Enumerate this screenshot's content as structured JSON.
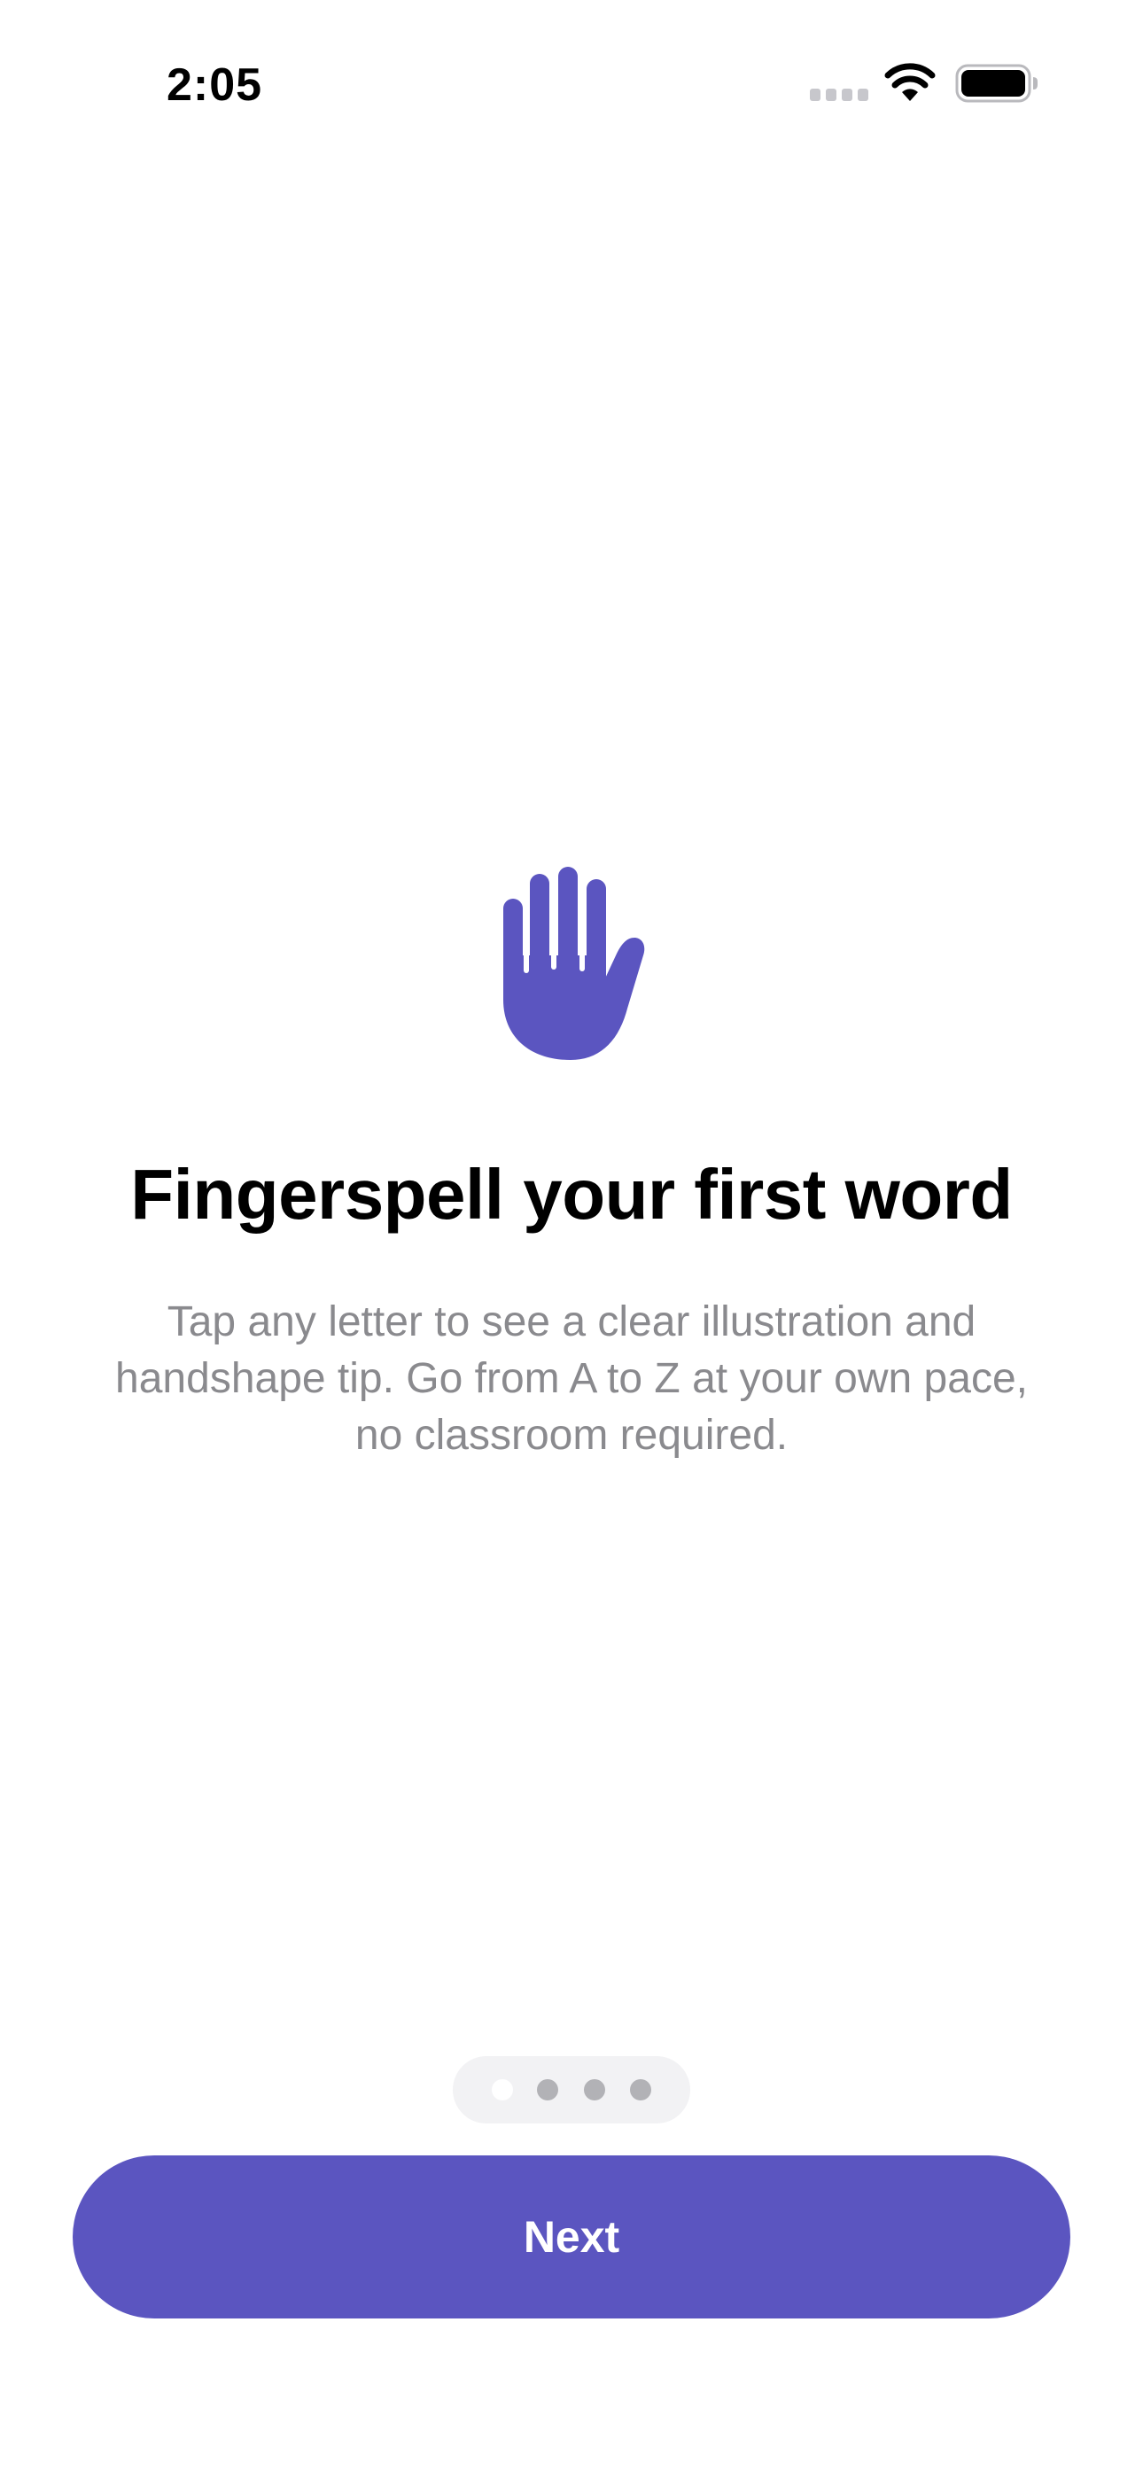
{
  "status_bar": {
    "time": "2:05",
    "icons": [
      "cellular-signal-icon",
      "wifi-icon",
      "battery-icon"
    ]
  },
  "onboarding": {
    "hero_icon": "raised-hand-icon",
    "title": "Fingerspell your first word",
    "description": "Tap any letter to see a clear illustration and handshape tip. Go from A to Z at your own pace, no classroom required.",
    "page_indicator": {
      "current_page": 1,
      "total_pages": 4
    },
    "next_button_label": "Next"
  },
  "colors": {
    "accent": "#5b55c0",
    "title_text": "#000000",
    "body_text": "#8a8a8e",
    "background": "#ffffff",
    "indicator_track": "#f2f2f4",
    "indicator_dot": "#b2b2b6",
    "indicator_dot_active": "#ffffff"
  }
}
